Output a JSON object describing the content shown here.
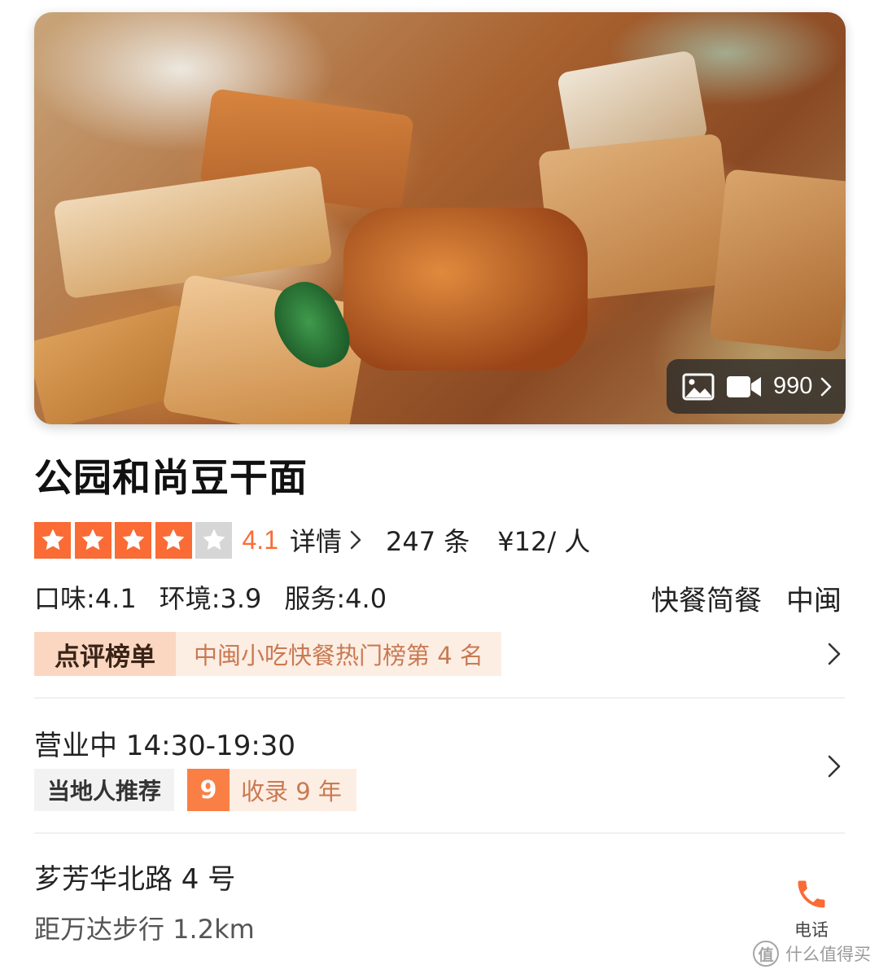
{
  "hero": {
    "media_count": "990",
    "icons": [
      "image-icon",
      "video-icon",
      "chevron-right-icon"
    ]
  },
  "shop": {
    "name": "公园和尚豆干面",
    "stars_filled": 4,
    "stars_total": 5,
    "score": "4.1",
    "detail_label": "详情",
    "review_count": "247 条",
    "price": "¥12/ 人"
  },
  "subscores": {
    "taste": "口味:4.1",
    "environment": "环境:3.9",
    "service": "服务:4.0"
  },
  "categories": [
    "快餐简餐",
    "中闽"
  ],
  "ranking": {
    "label": "点评榜单",
    "text": "中闽小吃快餐热门榜第 4 名"
  },
  "hours": {
    "status_text": "营业中 14:30-19:30"
  },
  "tags": {
    "local": "当地人推荐",
    "years_number": "9",
    "years_text": "收录 9 年"
  },
  "location": {
    "address": "芗芳华北路 4 号",
    "distance": "距万达步行 1.2km"
  },
  "phone": {
    "label": "电话"
  },
  "watermark": {
    "icon_glyph": "值",
    "text": "什么值得买"
  },
  "colors": {
    "accent": "#fa6b35",
    "rank_label_bg": "#fbd7c2",
    "rank_text_bg": "#fdeee4",
    "rank_text_color": "#c97a52",
    "local_tag_bg": "#f2f2f2"
  }
}
